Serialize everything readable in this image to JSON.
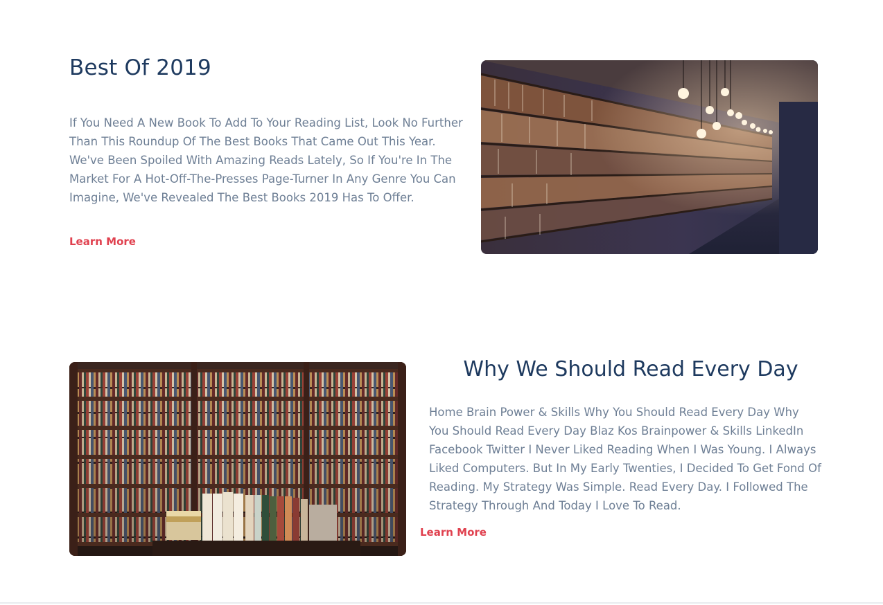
{
  "colors": {
    "heading": "#1e3a5f",
    "body_text": "#6e7f95",
    "link": "#e0414f",
    "background": "#ffffff"
  },
  "sections": [
    {
      "title": "Best Of 2019",
      "body": "If You Need A New Book To Add To Your Reading List, Look No Further Than This Roundup Of The Best Books That Came Out This Year. We've Been Spoiled With Amazing Reads Lately, So If You're In The Market For A Hot-Off-The-Presses Page-Turner In Any Genre You Can Imagine, We've Revealed The Best Books 2019 Has To Offer.",
      "link_label": "Learn More",
      "image": "library-aisle-with-hanging-lights-photo"
    },
    {
      "title": "Why We Should Read Every Day",
      "body": "Home Brain Power & Skills Why You Should Read Every Day Why You Should Read Every Day Blaz Kos Brainpower & Skills LinkedIn Facebook Twitter I Never Liked Reading When I Was Young. I Always Liked Computers. But In My Early Twenties, I Decided To Get Fond Of Reading. My Strategy Was Simple. Read Every Day. I Followed The Strategy Through And Today I Love To Read.",
      "link_label": "Learn More",
      "image": "bookshop-shelves-photo"
    }
  ]
}
